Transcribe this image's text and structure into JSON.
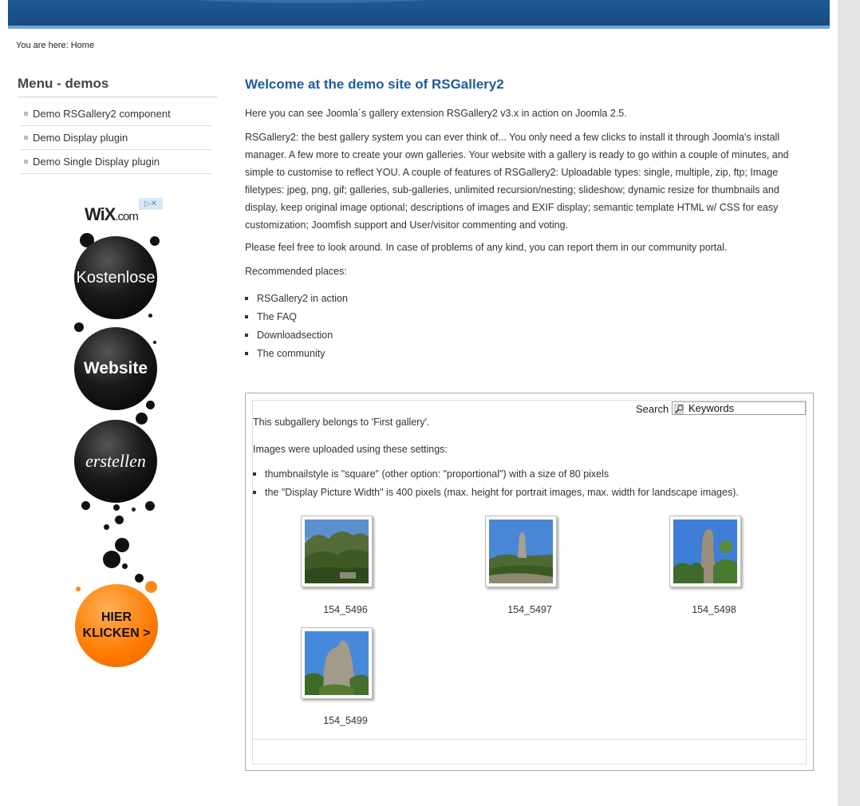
{
  "breadcrumb": {
    "prefix": "You are here:",
    "current": "Home"
  },
  "sidebar": {
    "title": "Menu - demos",
    "items": [
      {
        "label": "Demo RSGallery2 component"
      },
      {
        "label": "Demo Display plugin"
      },
      {
        "label": "Demo Single Display plugin"
      }
    ]
  },
  "ad": {
    "brand": "WiX",
    "brand_suffix": ".com",
    "ball1": "Kostenlose",
    "ball2": "Website",
    "ball3": "erstellen",
    "cta": [
      "HIER",
      "KLICKEN >"
    ]
  },
  "content": {
    "title": "Welcome at the demo site of RSGallery2",
    "intro": "Here you can see Joomla´s gallery extension RSGallery2 v3.x in action on Joomla 2.5.",
    "description": "RSGallery2: the best gallery system you can ever think of... You only need a few clicks to install it through Joomla's install manager. A few more to create your own galleries. Your website with a gallery is ready to go within a couple of minutes, and simple to customise to reflect YOU. A couple of features of RSGallery2: Uploadable types: single, multiple, zip, ftp; Image filetypes: jpeg, png, gif; galleries, sub-galleries, unlimited recursion/nesting; slideshow; dynamic resize for thumbnails and display, keep original image optional; descriptions of images and EXIF display; semantic template HTML w/ CSS for easy customization; Joomfish support and User/visitor commenting and voting.",
    "feedback": "Please feel free to look around. In case of problems of any kind, you can report them in our community portal.",
    "recommended_label": "Recommended places:",
    "places": [
      {
        "label": "RSGallery2 in action"
      },
      {
        "label": "The FAQ"
      },
      {
        "label": "Downloadsection"
      },
      {
        "label": "The community"
      }
    ]
  },
  "gallery": {
    "search_label": "Search",
    "search_value": "Keywords",
    "subgallery_note": "This subgallery belongs to 'First gallery'.",
    "settings_intro": "Images were uploaded using these settings:",
    "settings": [
      {
        "label": "thumbnailstyle is \"square\" (other option: \"proportional\") with a size of 80 pixels"
      },
      {
        "label": "the \"Display Picture Width\" is 400 pixels (max. height for portrait images, max. width for landscape images)."
      }
    ],
    "images": [
      {
        "caption": "154_5496"
      },
      {
        "caption": "154_5497"
      },
      {
        "caption": "154_5498"
      },
      {
        "caption": "154_5499"
      }
    ]
  },
  "colors": {
    "header_blue": "#1a5288",
    "title_blue": "#1f5b9a",
    "cta_orange": "#ff7a00"
  }
}
